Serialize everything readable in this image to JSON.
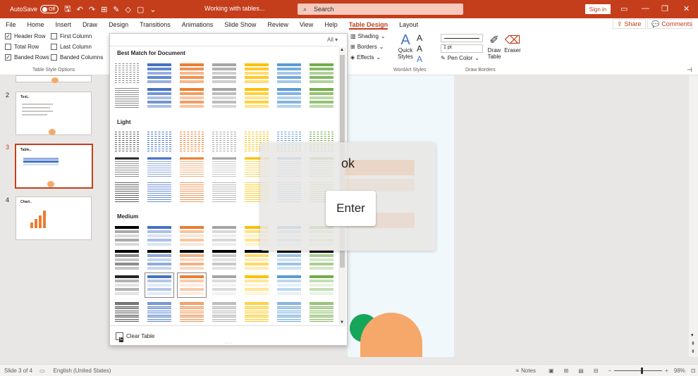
{
  "titlebar": {
    "autosave_label": "AutoSave",
    "autosave_state": "Off",
    "doc_title": "Working with tables...",
    "search_placeholder": "Search",
    "signin_label": "Sign in",
    "minimize": "—",
    "restore": "❐",
    "close": "✕"
  },
  "tabs": [
    "File",
    "Home",
    "Insert",
    "Draw",
    "Design",
    "Transitions",
    "Animations",
    "Slide Show",
    "Review",
    "View",
    "Help",
    "Table Design",
    "Layout"
  ],
  "active_tab": "Table Design",
  "share_label": "Share",
  "comments_label": "Comments",
  "ribbon": {
    "options": {
      "header_row": "Header Row",
      "first_column": "First Column",
      "total_row": "Total Row",
      "last_column": "Last Column",
      "banded_rows": "Banded Rows",
      "banded_columns": "Banded Columns",
      "group_label": "Table Style Options"
    },
    "checked": {
      "header_row": true,
      "first_column": false,
      "total_row": false,
      "last_column": false,
      "banded_rows": true,
      "banded_columns": false
    },
    "shading": "Shading",
    "borders": "Borders",
    "effects": "Effects",
    "quick_styles": "Quick Styles",
    "wordart_label": "WordArt Styles",
    "pen_weight": "1 pt",
    "pen_color": "Pen Color",
    "draw_table": "Draw Table",
    "eraser": "Eraser",
    "draw_borders_label": "Draw Borders"
  },
  "slides": [
    {
      "num": "2",
      "title": "Text.."
    },
    {
      "num": "3",
      "title": "Table.."
    },
    {
      "num": "4",
      "title": "Chart.."
    }
  ],
  "selected_slide": "3",
  "gallery": {
    "filter": "All",
    "section_best": "Best Match for Document",
    "section_light": "Light",
    "section_medium": "Medium",
    "clear_table": "Clear Table",
    "clear_shortcut": "C",
    "theme_colors": [
      "#404040",
      "#4472c4",
      "#ed7d31",
      "#a5a5a5",
      "#ffc000",
      "#5b9bd5",
      "#70ad47"
    ]
  },
  "overlay": {
    "typed_text": "ok",
    "key_label": "Enter"
  },
  "statusbar": {
    "slide_info": "Slide 3 of 4",
    "language": "English (United States)",
    "notes": "Notes",
    "zoom": "98%"
  }
}
